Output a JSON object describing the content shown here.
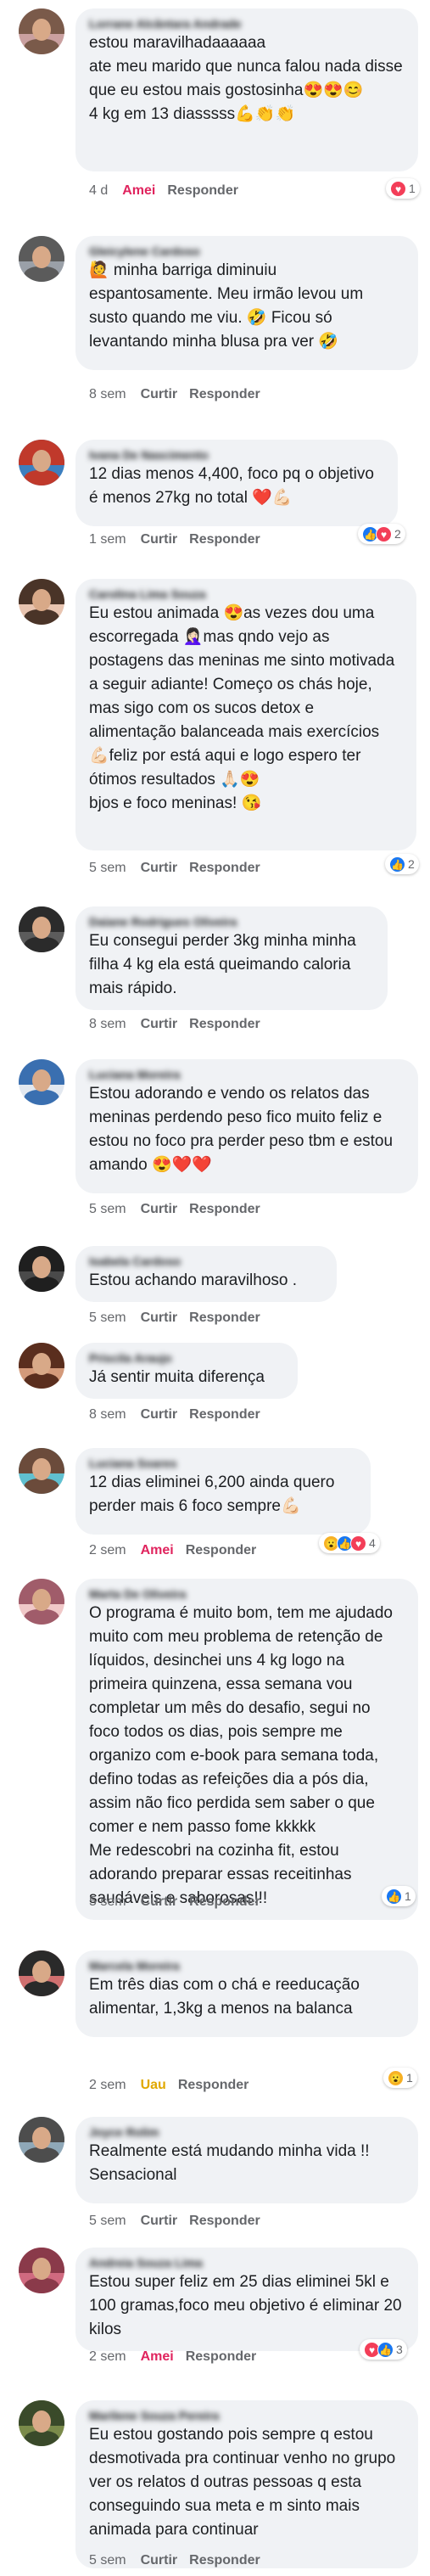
{
  "comments": [
    {
      "author": "Lorrane Alcântara Andrade",
      "text": "estou maravilhadaaaaaa\nate meu marido que nunca falou nada disse que eu estou mais gostosinha😍😍😊\n4 kg em 13 diasssss💪👏👏",
      "time": "4 d",
      "react_label": "Amei",
      "reply_label": "Responder",
      "reactions": [
        "love"
      ],
      "count": "1"
    },
    {
      "author": "Gleicylene Cardoso",
      "text": "🙋 minha barriga diminuiu espantosamente. Meu irmão levou um susto quando me viu. 🤣 Ficou só levantando minha blusa pra ver 🤣",
      "time": "8 sem",
      "like_label": "Curtir",
      "reply_label": "Responder"
    },
    {
      "author": "Ivana De Nascimento",
      "text": "12 dias menos 4,400, foco pq o objetivo é menos 27kg no total ❤️💪🏻",
      "time": "1 sem",
      "like_label": "Curtir",
      "reply_label": "Responder",
      "reactions": [
        "like",
        "love"
      ],
      "count": "2"
    },
    {
      "author": "Carolina Lima Souza",
      "text": "Eu estou animada 😍as vezes dou uma escorregada 🤦🏻‍♀️mas qndo vejo as postagens das meninas me sinto motivada a seguir adiante! Começo os chás hoje, mas sigo com os sucos detox e alimentação balanceada mais exercícios 💪🏻feliz por está aqui e logo espero ter ótimos resultados 🙏🏻😍\nbjos e foco meninas! 😘",
      "time": "5 sem",
      "like_label": "Curtir",
      "reply_label": "Responder",
      "reactions": [
        "like"
      ],
      "count": "2"
    },
    {
      "author": "Daiane Rodrigues Oliveira",
      "text": "Eu consegui perder 3kg minha minha filha 4 kg ela está queimando caloria mais rápido.",
      "time": "8 sem",
      "like_label": "Curtir",
      "reply_label": "Responder"
    },
    {
      "author": "Luciana Moreira",
      "text": "Estou adorando e vendo os relatos das meninas perdendo peso fico muito feliz e estou no foco pra perder peso tbm e estou amando 😍❤️❤️",
      "time": "5 sem",
      "like_label": "Curtir",
      "reply_label": "Responder"
    },
    {
      "author": "Isabela Cardoso",
      "text": "Estou achando maravilhoso .",
      "time": "5 sem",
      "like_label": "Curtir",
      "reply_label": "Responder"
    },
    {
      "author": "Priscila Araujo",
      "text": "Já sentir muita diferença",
      "time": "8 sem",
      "like_label": "Curtir",
      "reply_label": "Responder"
    },
    {
      "author": "Luciana Soares",
      "text": "12 dias eliminei 6,200 ainda quero perder mais 6 foco sempre💪🏻",
      "time": "2 sem",
      "react_label": "Amei",
      "reply_label": "Responder",
      "reactions": [
        "wow",
        "like",
        "love"
      ],
      "count": "4"
    },
    {
      "author": "Marta De Oliveira",
      "text": "O programa é muito bom, tem me ajudado muito com meu problema de retenção de líquidos, desinchei uns 4 kg logo na primeira quinzena, essa semana vou completar um mês do desafio, segui no foco todos os dias, pois sempre me organizo com e-book para semana toda, defino todas as refeições dia a pós dia, assim não fico perdida sem saber o que comer e nem passo fome kkkkk\nMe redescobri na cozinha fit, estou adorando preparar essas receitinhas saudáveis e saborosas!!!",
      "time": "5 sem",
      "like_label": "Curtir",
      "reply_label": "Responder",
      "reactions": [
        "like"
      ],
      "count": "1"
    },
    {
      "author": "Marcela Moreira",
      "text": "Em três dias com o chá e reeducação alimentar, 1,3kg a menos na balanca",
      "time": "2 sem",
      "react_label": "Uau",
      "reply_label": "Responder",
      "reactions": [
        "wow"
      ],
      "count": "1"
    },
    {
      "author": "Joyce Rolim",
      "text": "Realmente está mudando minha vida !! Sensacional",
      "time": "5 sem",
      "like_label": "Curtir",
      "reply_label": "Responder"
    },
    {
      "author": "Andreia Souza Lima",
      "text": "Estou super feliz em 25 dias eliminei 5kl e 100 gramas,foco meu objetivo é eliminar 20 kilos",
      "time": "2 sem",
      "react_label": "Amei",
      "reply_label": "Responder",
      "reactions": [
        "love",
        "like"
      ],
      "count": "3"
    },
    {
      "author": "Marilene Souza Pereira",
      "text": "Eu estou gostando pois sempre q estou desmotivada pra continuar venho no grupo ver os relatos d outras pessoas q esta conseguindo sua meta e m sinto mais animada para continuar",
      "time": "5 sem",
      "like_label": "Curtir",
      "reply_label": "Responder"
    }
  ],
  "colors": {
    "bubble": "#f0f2f5",
    "meta": "#65676b",
    "love_red": "#e0245e",
    "wow_yellow": "#e0a800",
    "like_blue": "#1877f2"
  },
  "icons": {
    "like": "like-icon",
    "love": "love-icon",
    "wow": "wow-icon"
  }
}
